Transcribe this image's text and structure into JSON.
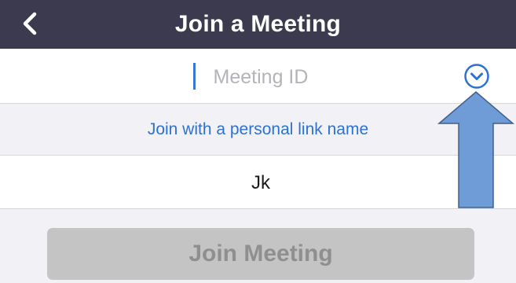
{
  "header": {
    "title": "Join a Meeting",
    "back_icon": "chevron-left-icon"
  },
  "meeting_id": {
    "value": "",
    "placeholder": "Meeting ID",
    "dropdown_icon": "chevron-down-circle-icon"
  },
  "personal_link": {
    "label": "Join with a personal link name"
  },
  "name_field": {
    "value": "Jk"
  },
  "join_button": {
    "label": "Join Meeting"
  },
  "colors": {
    "header_bg": "#3b3a4f",
    "accent": "#2d72d2",
    "disabled_button": "#c4c4c4",
    "annotation_arrow": "#6f9bd6"
  }
}
